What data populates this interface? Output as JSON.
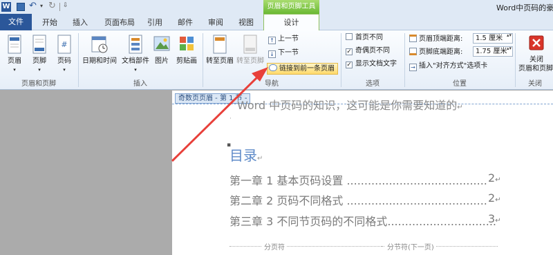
{
  "window": {
    "title": "Word中页码的豪"
  },
  "tool_context": {
    "label": "页眉和页脚工具"
  },
  "tabs": {
    "file": "文件",
    "home": "开始",
    "insert": "插入",
    "layout": "页面布局",
    "references": "引用",
    "mailings": "邮件",
    "review": "审阅",
    "view": "视图",
    "design": "设计"
  },
  "ribbon": {
    "header_footer_group": {
      "label": "页眉和页脚",
      "header": "页眉",
      "footer": "页脚",
      "page_number": "页码"
    },
    "insert_group": {
      "label": "插入",
      "date_time": "日期和时间",
      "doc_parts": "文档部件",
      "picture": "图片",
      "clip_art": "剪贴画"
    },
    "nav_group": {
      "label": "导航",
      "goto_header": "转至页眉",
      "goto_footer": "转至页脚",
      "previous": "上一节",
      "next": "下一节",
      "link_previous": "链接到前一条页眉"
    },
    "options_group": {
      "label": "选项",
      "different_first": "首页不同",
      "odd_even": "奇偶页不同",
      "show_text": "显示文档文字",
      "different_first_checked": false,
      "odd_even_checked": true,
      "show_text_checked": true
    },
    "position_group": {
      "label": "位置",
      "header_top_label": "页眉顶端距离:",
      "header_top_value": "1.5 厘米",
      "footer_bottom_label": "页脚底端距离:",
      "footer_bottom_value": "1.75 厘米",
      "align_tab": "插入\"对齐方式\"选项卡"
    },
    "close_group": {
      "label": "关闭",
      "close_line1": "关闭",
      "close_line2": "页眉和页脚"
    }
  },
  "document": {
    "header_tag": "奇数页页眉 - 第 1 节 -",
    "header_text": "Word 中页码的知识，这可能是你需要知道的",
    "toc_title": "目录",
    "toc_entries": [
      {
        "text": "第一章 1 基本页码设置 ........................................",
        "page": "2"
      },
      {
        "text": "第二章 2 页码不同格式 ........................................",
        "page": "2"
      },
      {
        "text": "第三章 3 不同节页码的不同格式...............................",
        "page": "3"
      }
    ],
    "page_break": "分页符",
    "section_break": "分节符(下一页)"
  },
  "colors": {
    "accent": "#2b579a",
    "context_green": "#6ab934",
    "arrow": "#e8403a"
  }
}
